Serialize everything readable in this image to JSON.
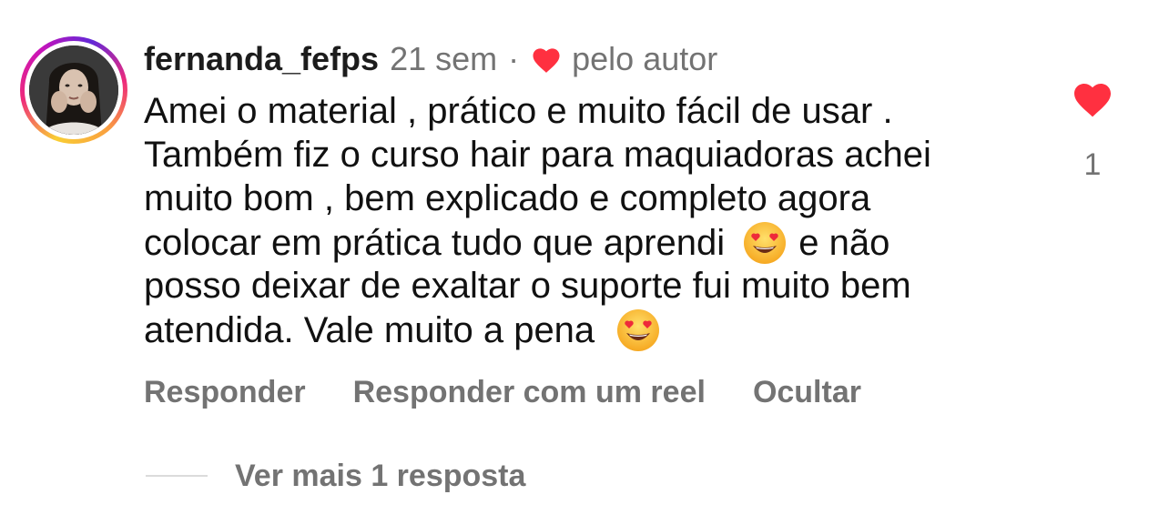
{
  "comment": {
    "username": "fernanda_fefps",
    "time_ago": "21 sem",
    "separator": "·",
    "liked_by_author_label": "pelo autor",
    "text_lines": [
      "Amei o material , prático e muito  fácil de usar .",
      "Também fiz o curso hair para maquiadoras achei",
      "muito bom , bem explicado e completo agora",
      "colocar em prática tudo que aprendi",
      "e não",
      "posso deixar de exaltar o suporte fui muito bem",
      "atendida. Vale muito a pena"
    ],
    "emoji": "heart-eyes",
    "like_count": "1",
    "icons": {
      "author_heart": "heart-icon",
      "like": "heart-icon",
      "avatar": "avatar"
    },
    "colors": {
      "heart_red": "#ff3040",
      "meta_gray": "#737373"
    }
  },
  "actions": {
    "reply": "Responder",
    "reply_with_reel": "Responder com um reel",
    "hide": "Ocultar"
  },
  "replies": {
    "view_more": "Ver mais 1 resposta"
  }
}
